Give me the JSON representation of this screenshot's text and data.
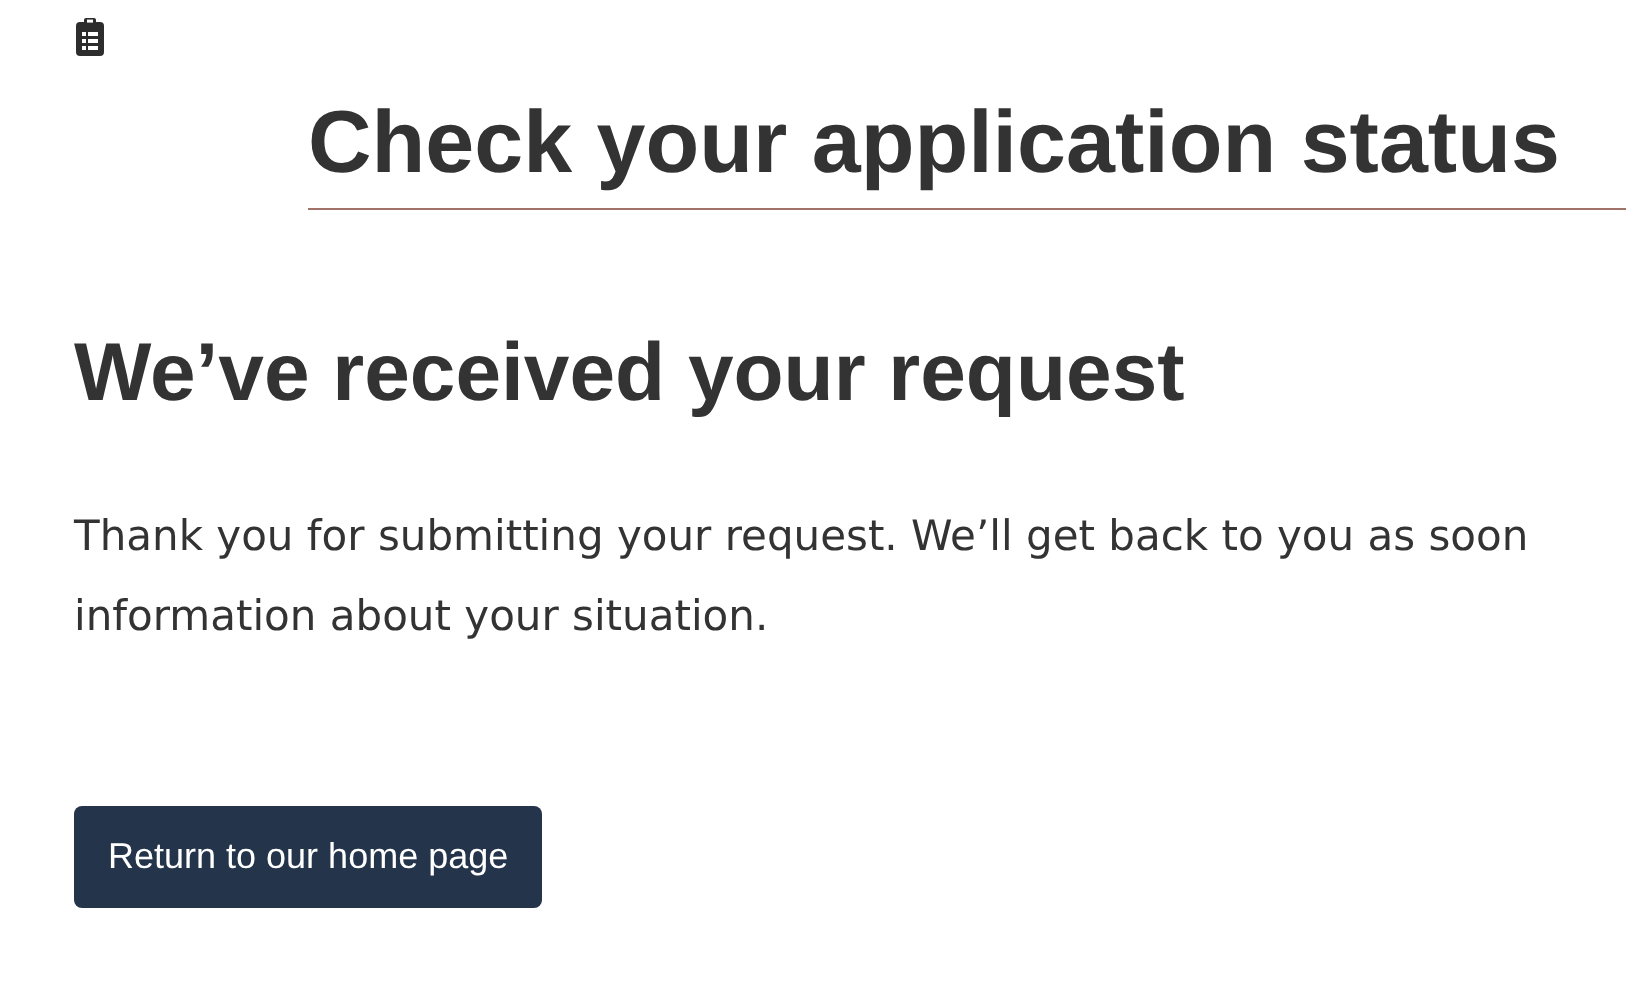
{
  "page_title": "Check your application status",
  "heading": "We’ve received your request",
  "message_lines": [
    "Thank you for submitting your request. We’ll get back to you as soon",
    "information about your situation."
  ],
  "button": "Return to our home page"
}
